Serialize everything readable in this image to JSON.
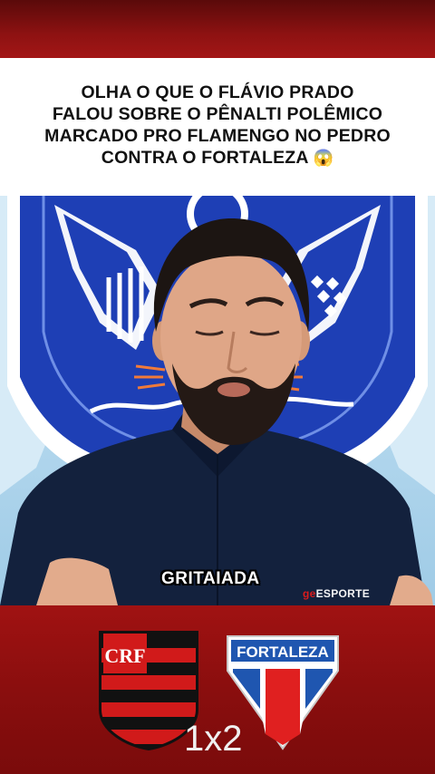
{
  "headline": {
    "lines": [
      "OLHA O QUE O FLÁVIO PRADO",
      "FALOU SOBRE O PÊNALTI POLÊMICO",
      "MARCADO PRO FLAMENGO NO PEDRO",
      "CONTRA O FORTALEZA"
    ],
    "emoji": "😱"
  },
  "video": {
    "caption": "GRITAIADA",
    "watermark_prefix": "ge",
    "watermark_suffix": "ESPORTE"
  },
  "match": {
    "home_crest_text": "CRF",
    "away_crest_text": "FORTALEZA",
    "score": "1x2"
  },
  "colors": {
    "brand_red": "#a31616",
    "flamengo_red": "#d11a1a",
    "flamengo_black": "#111111",
    "fortaleza_blue": "#1f56b0",
    "fortaleza_red": "#e02020",
    "backdrop_blue": "#1e3fb5"
  }
}
